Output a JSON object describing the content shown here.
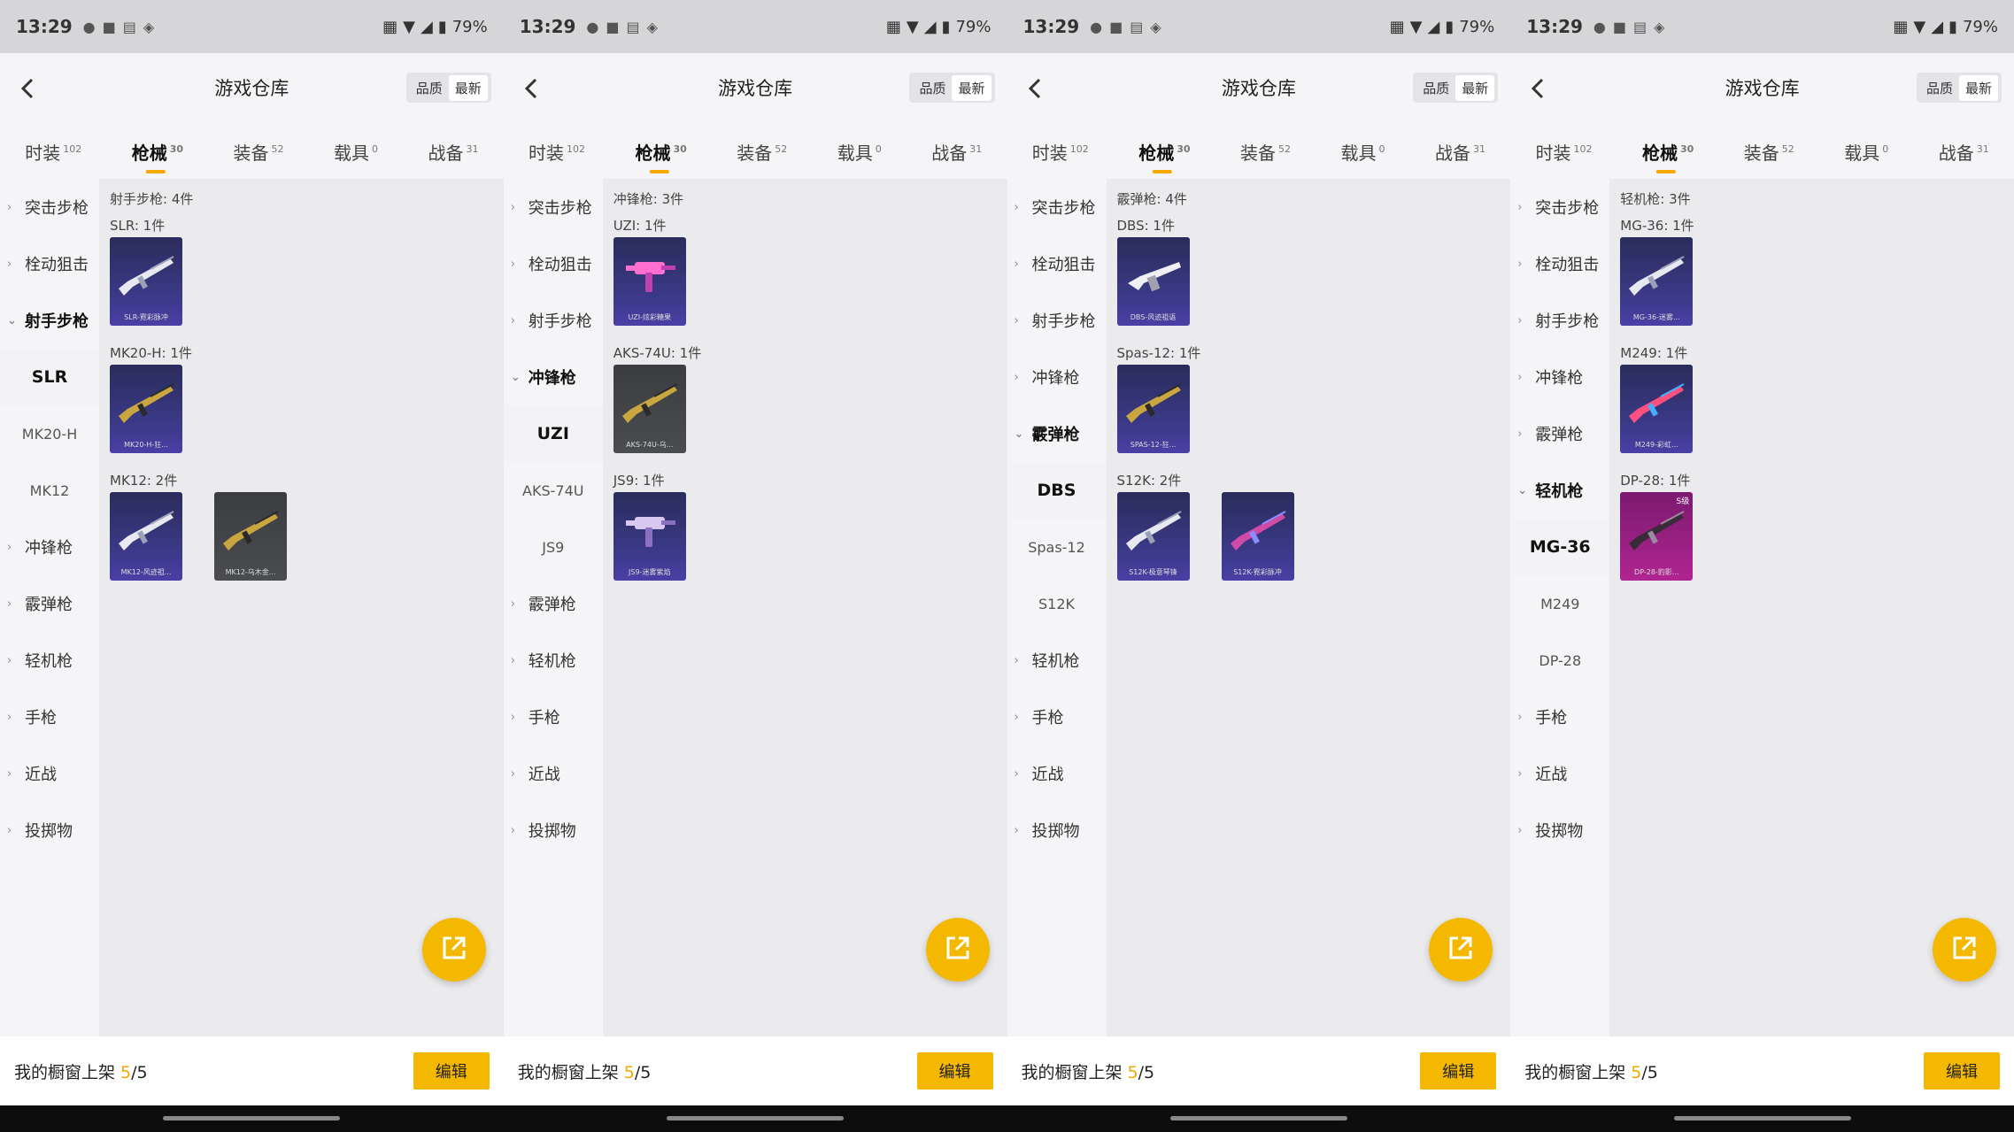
{
  "status": {
    "time": "13:29",
    "battery": "79%"
  },
  "header": {
    "title": "游戏仓库",
    "sort_quality": "品质",
    "sort_latest": "最新"
  },
  "tabs": [
    {
      "label": "时装",
      "count": "102"
    },
    {
      "label": "枪械",
      "count": "30",
      "active": true
    },
    {
      "label": "装备",
      "count": "52"
    },
    {
      "label": "载具",
      "count": "0"
    },
    {
      "label": "战备",
      "count": "31"
    }
  ],
  "categories": [
    "突击步枪",
    "栓动狙击",
    "射手步枪",
    "冲锋枪",
    "霰弹枪",
    "轻机枪",
    "手枪",
    "近战",
    "投掷物"
  ],
  "footer": {
    "shelf_label": "我的橱窗上架 ",
    "shelf_current": "5",
    "shelf_total": "/5",
    "edit": "编辑"
  },
  "colors": {
    "accent": "#f5b800",
    "card_purple": "#3c3a8a",
    "card_gray": "#4a4c4f",
    "card_magenta": "#b02590"
  },
  "panels": [
    {
      "open_category": "射手步枪",
      "subs": [
        "SLR",
        "MK20-H",
        "MK12"
      ],
      "active_sub": "SLR",
      "section": "射手步枪: 4件",
      "groups": [
        {
          "label": "SLR: 1件",
          "items": [
            {
              "caption": "SLR-霓彩脉冲",
              "tone": "purple",
              "art": "rifle-white"
            }
          ]
        },
        {
          "label": "MK20-H: 1件",
          "items": [
            {
              "caption": "MK20-H-狂...",
              "tone": "purple",
              "art": "rifle-gold"
            }
          ]
        },
        {
          "label": "MK12: 2件",
          "items": [
            {
              "caption": "MK12-风迹祖...",
              "tone": "purple",
              "art": "rifle-white"
            },
            {
              "caption": "MK12-乌木金...",
              "tone": "gray",
              "art": "rifle-gold"
            }
          ]
        }
      ]
    },
    {
      "open_category": "冲锋枪",
      "subs": [
        "UZI",
        "AKS-74U",
        "JS9"
      ],
      "active_sub": "UZI",
      "section": "冲锋枪: 3件",
      "groups": [
        {
          "label": "UZI: 1件",
          "items": [
            {
              "caption": "UZI-炫彩糖果",
              "tone": "purple",
              "art": "smg-pink"
            }
          ]
        },
        {
          "label": "AKS-74U: 1件",
          "items": [
            {
              "caption": "AKS-74U-乌...",
              "tone": "gray",
              "art": "rifle-gold"
            }
          ]
        },
        {
          "label": "JS9: 1件",
          "items": [
            {
              "caption": "JS9-迷雾紫焰",
              "tone": "purple",
              "art": "smg-white"
            }
          ]
        }
      ]
    },
    {
      "open_category": "霰弹枪",
      "subs": [
        "DBS",
        "Spas-12",
        "S12K"
      ],
      "active_sub": "DBS",
      "section": "霰弹枪: 4件",
      "groups": [
        {
          "label": "DBS: 1件",
          "items": [
            {
              "caption": "DBS-风迹祖语",
              "tone": "purple",
              "art": "shotgun-white"
            }
          ]
        },
        {
          "label": "Spas-12: 1件",
          "items": [
            {
              "caption": "SPAS-12-狂...",
              "tone": "purple",
              "art": "rifle-gold"
            }
          ]
        },
        {
          "label": "S12K: 2件",
          "items": [
            {
              "caption": "S12K-极意琴锋",
              "tone": "purple",
              "art": "rifle-white"
            },
            {
              "caption": "S12K-霓彩脉冲",
              "tone": "purple",
              "art": "rifle-pink"
            }
          ]
        }
      ]
    },
    {
      "open_category": "轻机枪",
      "subs": [
        "MG-36",
        "M249",
        "DP-28"
      ],
      "active_sub": "MG-36",
      "section": "轻机枪: 3件",
      "groups": [
        {
          "label": "MG-36: 1件",
          "items": [
            {
              "caption": "MG-36-迷雾...",
              "tone": "purple",
              "art": "rifle-white"
            }
          ]
        },
        {
          "label": "M249: 1件",
          "items": [
            {
              "caption": "M249-彩虹...",
              "tone": "purple",
              "art": "lmg-pink"
            }
          ]
        },
        {
          "label": "DP-28: 1件",
          "items": [
            {
              "caption": "DP-28-豹影...",
              "tone": "magenta",
              "art": "rifle-dark",
              "tag": "S级"
            }
          ]
        }
      ]
    }
  ]
}
